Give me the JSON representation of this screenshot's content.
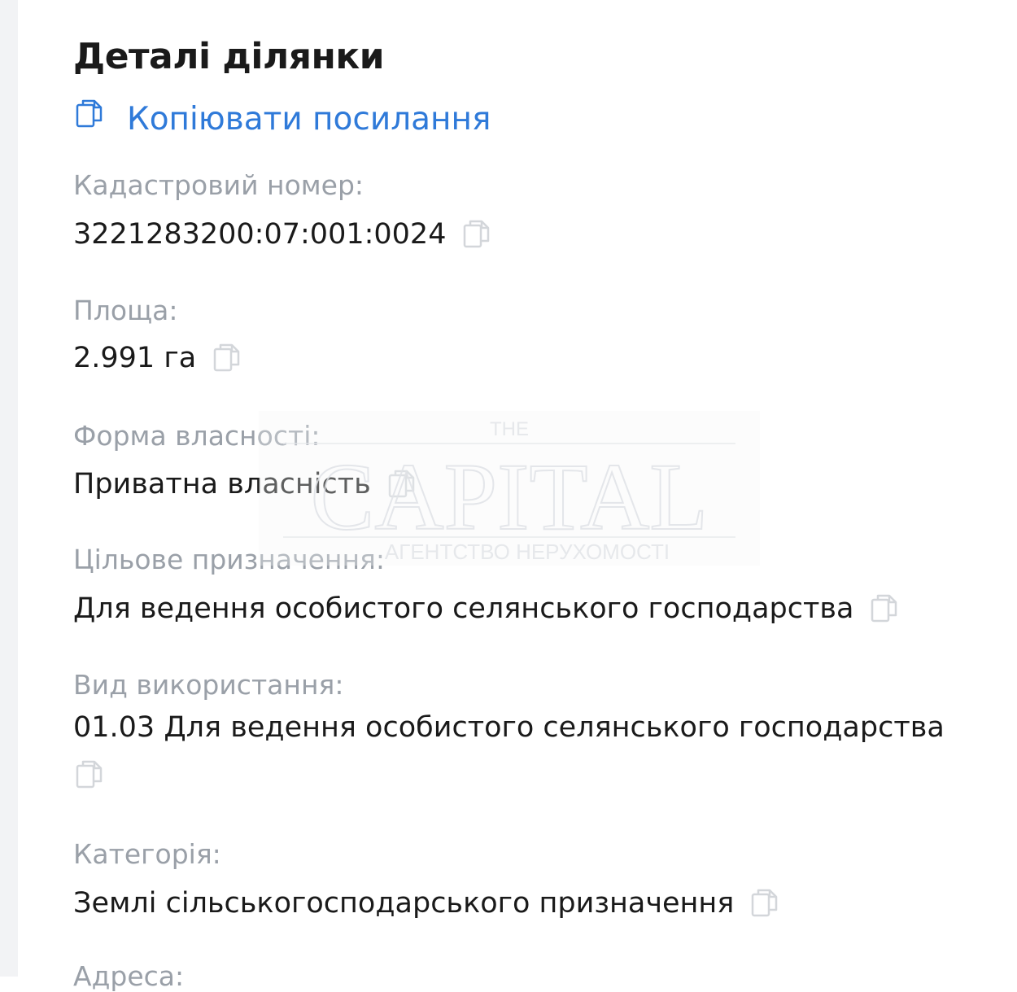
{
  "panel": {
    "title": "Деталі ділянки",
    "copy_link_label": "Копіювати посилання"
  },
  "fields": [
    {
      "label": "Кадастровий номер:",
      "value": "3221283200:07:001:0024"
    },
    {
      "label": "Площа:",
      "value": "2.991 га"
    },
    {
      "label": "Форма власності:",
      "value": "Приватна власність"
    },
    {
      "label": "Цільове призначення:",
      "value": "Для ведення особистого селянського господарства"
    },
    {
      "label": "Вид використання:",
      "value": "01.03 Для ведення особистого селянського господарства"
    },
    {
      "label": "Категорія:",
      "value": "Землі сільськогосподарського призначення"
    },
    {
      "label": "Адреса:"
    }
  ],
  "watermark": {
    "top": "THE",
    "main": "CAPITAL",
    "sub": "АГЕНТСТВО НЕРУХОМОСТІ"
  },
  "colors": {
    "link": "#2f7ad9",
    "label": "#9aa0a8",
    "value": "#1a1a1a",
    "icon_muted": "#d3d6da"
  }
}
